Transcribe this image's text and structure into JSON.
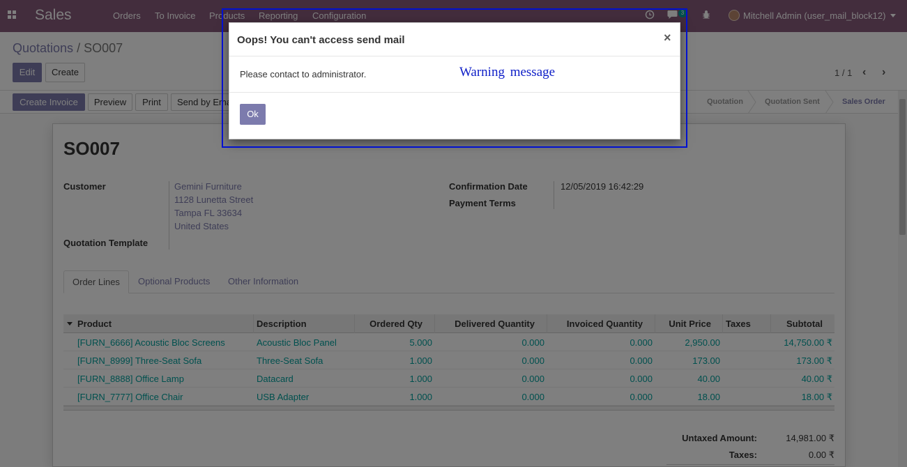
{
  "navbar": {
    "app_name": "Sales",
    "menus": [
      "Orders",
      "To Invoice",
      "Products",
      "Reporting",
      "Configuration"
    ],
    "chat_count": "3",
    "user": "Mitchell Admin (user_mail_block12)",
    "icons": [
      "apps-grid-icon",
      "clock-icon",
      "chat-icon",
      "bug-icon"
    ]
  },
  "breadcrumb": {
    "parent": "Quotations",
    "separator": "/",
    "current": "SO007"
  },
  "actions": {
    "edit": "Edit",
    "create": "Create"
  },
  "pager": {
    "text": "1 / 1",
    "prev": "‹",
    "next": "›"
  },
  "statusbar": {
    "buttons": {
      "create_invoice": "Create Invoice",
      "preview": "Preview",
      "print": "Print",
      "send_email": "Send by Email"
    },
    "stages": [
      "Quotation",
      "Quotation Sent",
      "Sales Order"
    ],
    "active_stage": "Sales Order"
  },
  "order": {
    "name": "SO007",
    "customer_label": "Customer",
    "customer_lines": [
      "Gemini Furniture",
      "1128 Lunetta Street",
      "Tampa FL 33634",
      "United States"
    ],
    "template_label": "Quotation Template",
    "confirmation_label": "Confirmation Date",
    "confirmation_date": "12/05/2019 16:42:29",
    "payment_terms_label": "Payment Terms"
  },
  "tabs": [
    "Order Lines",
    "Optional Products",
    "Other Information"
  ],
  "table": {
    "columns": [
      "Product",
      "Description",
      "Ordered Qty",
      "Delivered Quantity",
      "Invoiced Quantity",
      "Unit Price",
      "Taxes",
      "Subtotal"
    ],
    "rows": [
      [
        "[FURN_6666] Acoustic Bloc Screens",
        "Acoustic Bloc Panel",
        "5.000",
        "0.000",
        "0.000",
        "2,950.00",
        "",
        "14,750.00 ₹"
      ],
      [
        "[FURN_8999] Three-Seat Sofa",
        "Three-Seat Sofa",
        "1.000",
        "0.000",
        "0.000",
        "173.00",
        "",
        "173.00 ₹"
      ],
      [
        "[FURN_8888] Office Lamp",
        "Datacard",
        "1.000",
        "0.000",
        "0.000",
        "40.00",
        "",
        "40.00 ₹"
      ],
      [
        "[FURN_7777] Office Chair",
        "USB Adapter",
        "1.000",
        "0.000",
        "0.000",
        "18.00",
        "",
        "18.00 ₹"
      ]
    ]
  },
  "totals": {
    "untaxed_label": "Untaxed Amount:",
    "untaxed_value": "14,981.00 ₹",
    "taxes_label": "Taxes:",
    "taxes_value": "0.00 ₹"
  },
  "modal": {
    "title": "Oops! You can't access send mail",
    "close": "×",
    "message": "Please contact to administrator.",
    "ok": "Ok"
  },
  "annotation": {
    "text": "Warning message",
    "color": "#1020c8"
  },
  "colors": {
    "brand": "#875a7b",
    "primary": "#7c7bad",
    "link_teal": "#00a09d"
  }
}
